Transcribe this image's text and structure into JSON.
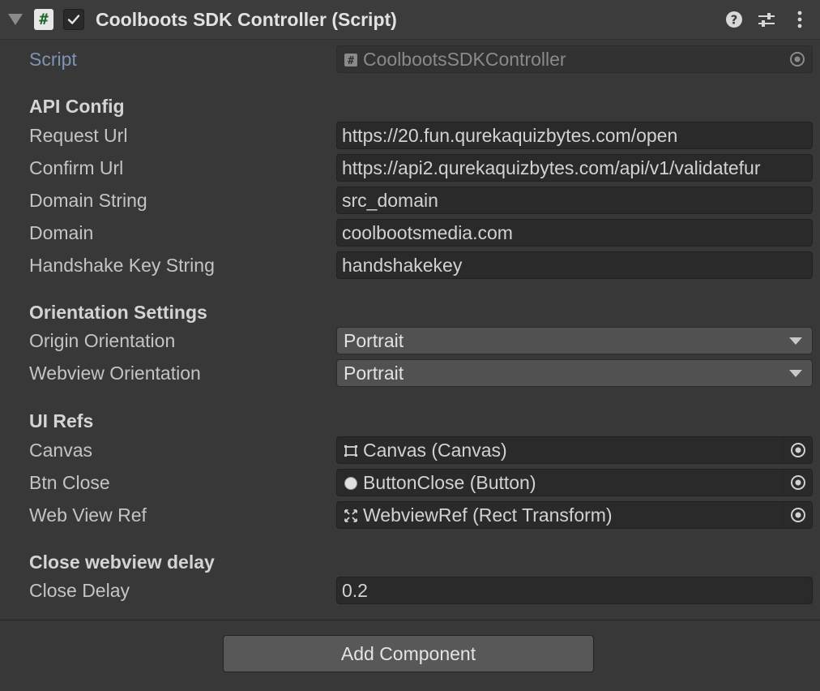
{
  "component": {
    "title": "Coolboots SDK Controller (Script)",
    "script_icon_glyph": "#",
    "enabled": true,
    "header_icons": [
      "help-icon",
      "presets-icon",
      "kebab-menu-icon"
    ]
  },
  "script_field": {
    "label": "Script",
    "value": "CoolbootsSDKController"
  },
  "sections": {
    "api_config": "API Config",
    "orientation": "Orientation Settings",
    "ui_refs": "UI Refs",
    "close_delay": "Close webview delay"
  },
  "api_config": {
    "request_url": {
      "label": "Request Url",
      "value": "https://20.fun.qurekaquizbytes.com/open"
    },
    "confirm_url": {
      "label": "Confirm Url",
      "value": "https://api2.qurekaquizbytes.com/api/v1/validatefur"
    },
    "domain_string": {
      "label": "Domain String",
      "value": "src_domain"
    },
    "domain": {
      "label": "Domain",
      "value": "coolbootsmedia.com"
    },
    "handshake_key": {
      "label": "Handshake Key String",
      "value": "handshakekey"
    }
  },
  "orientation": {
    "origin": {
      "label": "Origin Orientation",
      "value": "Portrait"
    },
    "webview": {
      "label": "Webview Orientation",
      "value": "Portrait"
    }
  },
  "ui_refs": {
    "canvas": {
      "label": "Canvas",
      "value": "Canvas (Canvas)",
      "icon": "canvas-icon"
    },
    "btn_close": {
      "label": "Btn Close",
      "value": "ButtonClose (Button)",
      "icon": "button-icon"
    },
    "web_view_ref": {
      "label": "Web View Ref",
      "value": "WebviewRef (Rect Transform)",
      "icon": "rect-transform-icon"
    }
  },
  "close_delay": {
    "label": "Close Delay",
    "value": "0.2"
  },
  "footer": {
    "add_component": "Add Component"
  },
  "colors": {
    "background": "#383838",
    "field_bg": "#2a2a2a",
    "dropdown_bg": "#515151",
    "script_label": "#7f93b4",
    "script_icon_fg": "#1f6a2e"
  }
}
